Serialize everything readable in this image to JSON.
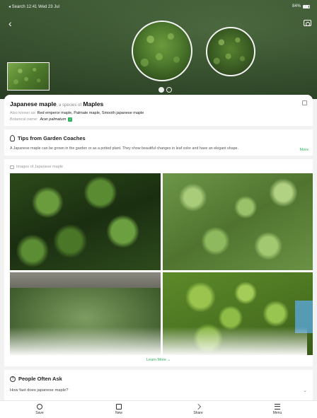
{
  "status_bar": {
    "left": "◂ Search  12:41  Wed 23 Jul",
    "right": "84%"
  },
  "plant": {
    "common_name": "Japanese maple",
    "species_connector": ", a species of",
    "genus": "Maples",
    "aka_label": "Also known as:",
    "aka_values": "Red emperor maple, Palmate maple, Smooth japanese maple",
    "botanical_label": "Botanical name:",
    "botanical_name": "Acer palmatum"
  },
  "tips": {
    "title": "Tips from Garden Coaches",
    "text": "A Japanese maple can be grown in the garden or as a potted plant. They show beautiful changes in leaf color and have an elegant shape.",
    "more": "More"
  },
  "images": {
    "label": "Images of Japanese maple",
    "learn_more": "Learn More ⌄"
  },
  "faq": {
    "title": "People Often Ask",
    "first_question": "How fast does japanese maple?"
  },
  "tabs": [
    {
      "label": "Save",
      "icon": "save-icon"
    },
    {
      "label": "New",
      "icon": "camera-icon"
    },
    {
      "label": "Share",
      "icon": "share-icon"
    },
    {
      "label": "Menu",
      "icon": "menu-icon"
    }
  ],
  "colors": {
    "accent": "#2fb35c",
    "hero": "#3a5530",
    "background": "#f2f2f2"
  }
}
